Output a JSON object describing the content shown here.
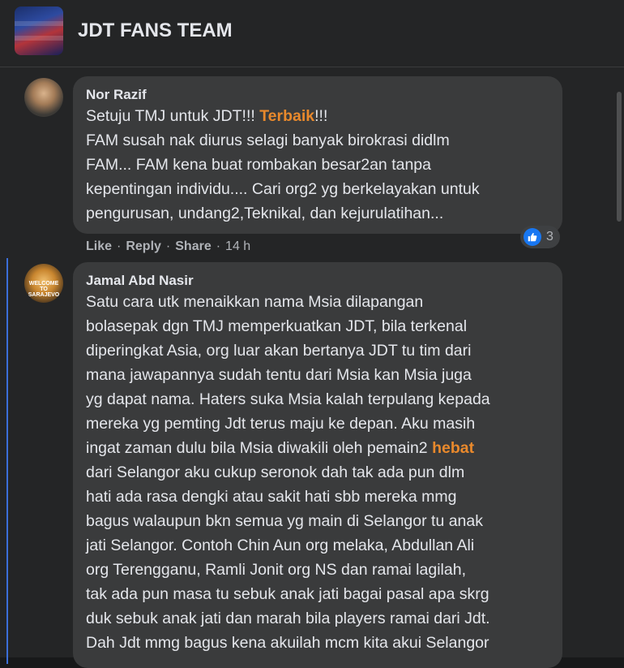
{
  "group": {
    "title": "JDT FANS TEAM"
  },
  "comments": [
    {
      "author": "Nor Razif",
      "lines": [
        {
          "parts": [
            {
              "text": "Setuju TMJ untuk JDT!!! ",
              "highlight": false
            },
            {
              "text": "Terbaik",
              "highlight": true
            },
            {
              "text": "!!!",
              "highlight": false
            }
          ]
        },
        {
          "parts": [
            {
              "text": "FAM susah nak diurus selagi banyak birokrasi didlm",
              "highlight": false
            }
          ]
        },
        {
          "parts": [
            {
              "text": "FAM... FAM kena buat rombakan besar2an tanpa",
              "highlight": false
            }
          ]
        },
        {
          "parts": [
            {
              "text": "kepentingan individu.... Cari org2 yg berkelayakan untuk",
              "highlight": false
            }
          ]
        },
        {
          "parts": [
            {
              "text": "pengurusan, undang2,Teknikal, dan kejurulatihan...",
              "highlight": false
            }
          ]
        }
      ],
      "actions": {
        "like": "Like",
        "reply": "Reply",
        "share": "Share",
        "time": "14 h"
      },
      "reaction_count": "3"
    },
    {
      "author": "Jamal Abd Nasir",
      "avatar_text": "WELCOME TO SARAJEVO",
      "lines": [
        {
          "parts": [
            {
              "text": "Satu cara utk menaikkan nama Msia dilapangan",
              "highlight": false
            }
          ]
        },
        {
          "parts": [
            {
              "text": "bolasepak dgn TMJ memperkuatkan JDT, bila terkenal",
              "highlight": false
            }
          ]
        },
        {
          "parts": [
            {
              "text": "diperingkat Asia, org luar akan bertanya JDT tu tim dari",
              "highlight": false
            }
          ]
        },
        {
          "parts": [
            {
              "text": "mana jawapannya sudah tentu dari Msia kan Msia juga",
              "highlight": false
            }
          ]
        },
        {
          "parts": [
            {
              "text": "yg dapat nama. Haters suka Msia kalah terpulang kepada",
              "highlight": false
            }
          ]
        },
        {
          "parts": [
            {
              "text": "mereka yg pemting Jdt terus maju ke depan. Aku masih",
              "highlight": false
            }
          ]
        },
        {
          "parts": [
            {
              "text": "ingat zaman dulu bila Msia diwakili oleh pemain2 ",
              "highlight": false
            },
            {
              "text": "hebat",
              "highlight": true
            }
          ]
        },
        {
          "parts": [
            {
              "text": "dari Selangor aku cukup seronok dah tak ada pun dlm",
              "highlight": false
            }
          ]
        },
        {
          "parts": [
            {
              "text": "hati ada rasa dengki atau sakit hati sbb mereka mmg",
              "highlight": false
            }
          ]
        },
        {
          "parts": [
            {
              "text": "bagus walaupun bkn semua yg main di Selangor tu anak",
              "highlight": false
            }
          ]
        },
        {
          "parts": [
            {
              "text": "jati Selangor. Contoh Chin Aun org melaka, Abdullan Ali",
              "highlight": false
            }
          ]
        },
        {
          "parts": [
            {
              "text": "org Terengganu, Ramli Jonit org NS dan ramai lagilah,",
              "highlight": false
            }
          ]
        },
        {
          "parts": [
            {
              "text": "tak ada pun masa tu sebuk anak jati bagai pasal apa skrg",
              "highlight": false
            }
          ]
        },
        {
          "parts": [
            {
              "text": "duk sebuk anak jati dan marah bila players ramai dari Jdt.",
              "highlight": false
            }
          ]
        },
        {
          "parts": [
            {
              "text": "Dah Jdt mmg bagus kena akuilah mcm kita akui Selangor",
              "highlight": false
            }
          ]
        }
      ]
    }
  ],
  "colors": {
    "highlight": "#e9892c",
    "like_blue": "#1877f2",
    "thread_line": "#3b6fd9"
  },
  "icons": {
    "reaction": "like-thumb-icon"
  }
}
